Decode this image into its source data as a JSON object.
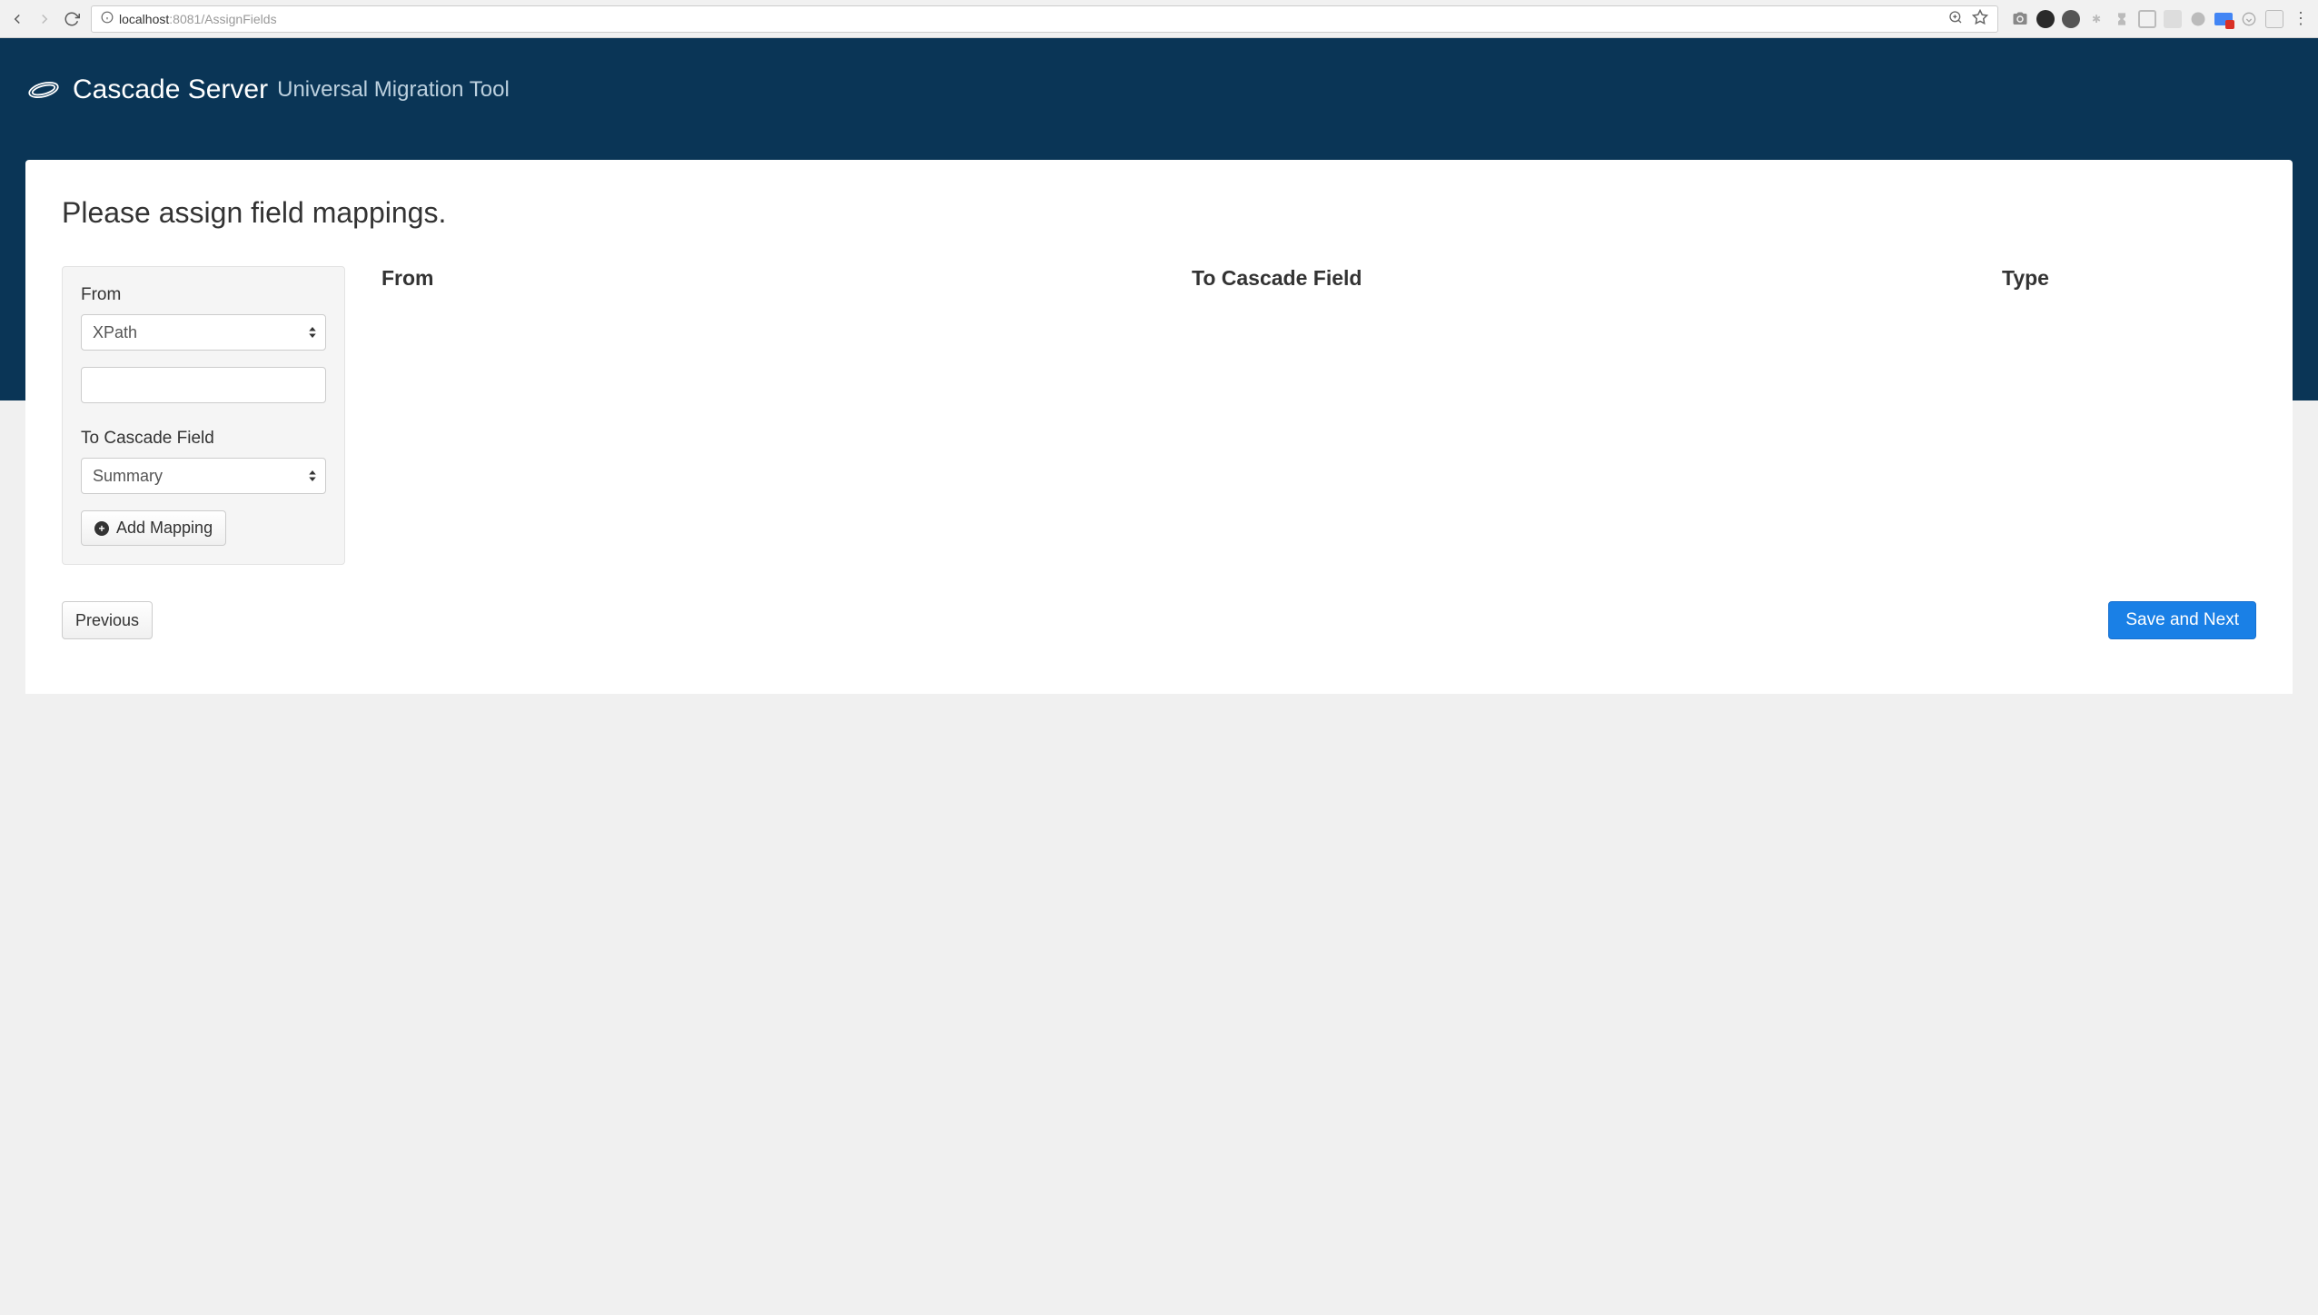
{
  "browser": {
    "url_host": "localhost",
    "url_port": ":8081",
    "url_path": "/AssignFields"
  },
  "header": {
    "brand": "Cascade Server",
    "subtitle": "Universal Migration Tool"
  },
  "page": {
    "title": "Please assign field mappings."
  },
  "form": {
    "from_label": "From",
    "from_select_value": "XPath",
    "from_input_value": "",
    "to_label": "To Cascade Field",
    "to_select_value": "Summary",
    "add_button": "Add Mapping"
  },
  "table": {
    "headers": {
      "from": "From",
      "to": "To Cascade Field",
      "type": "Type"
    },
    "rows": []
  },
  "footer": {
    "prev": "Previous",
    "next": "Save and Next"
  }
}
